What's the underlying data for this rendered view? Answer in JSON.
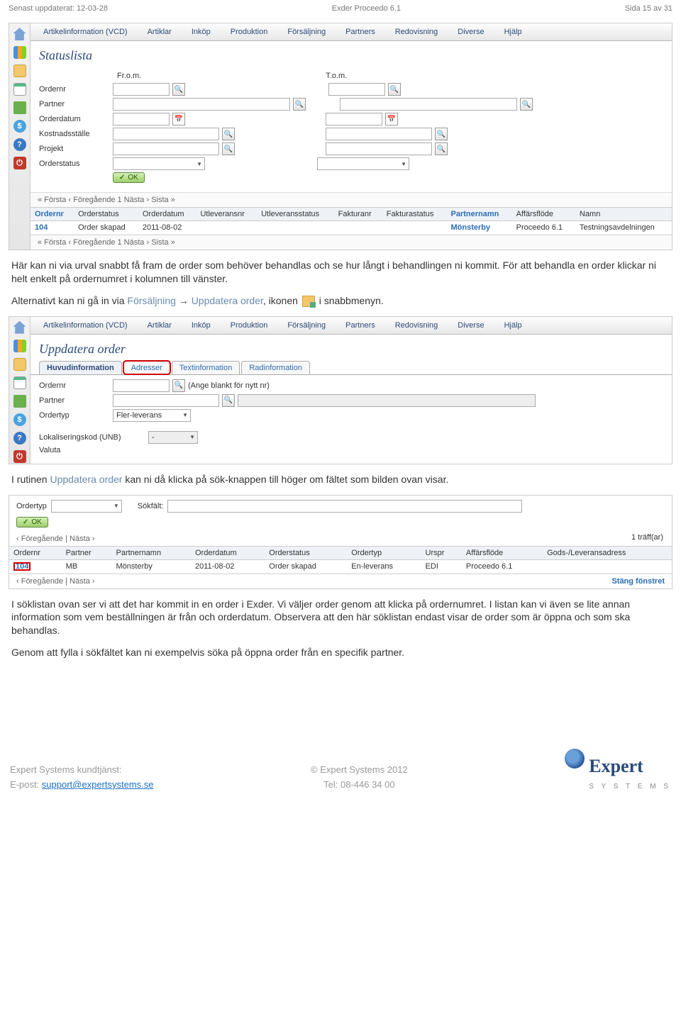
{
  "header": {
    "updated": "Senast uppdaterat: 12-03-28",
    "product": "Exder Proceedo 6.1",
    "page": "Sida 15 av 31"
  },
  "menubar": [
    "Artikelinformation (VCD)",
    "Artiklar",
    "Inköp",
    "Produktion",
    "Försäljning",
    "Partners",
    "Redovisning",
    "Diverse",
    "Hjälp"
  ],
  "shot1": {
    "title": "Statuslista",
    "col_from": "Fr.o.m.",
    "col_to": "T.o.m.",
    "labels": {
      "ordernr": "Ordernr",
      "partner": "Partner",
      "orderdatum": "Orderdatum",
      "kostnadsstalle": "Kostnadsställe",
      "projekt": "Projekt",
      "orderstatus": "Orderstatus"
    },
    "ok": "OK",
    "pager": "« Första ‹ Föregående 1 Nästa › Sista »",
    "table": {
      "headers": [
        "Ordernr",
        "Orderstatus",
        "Orderdatum",
        "Utleveransnr",
        "Utleveransstatus",
        "Fakturanr",
        "Fakturastatus",
        "Partnernamn",
        "Affärsflöde",
        "Namn"
      ],
      "row": [
        "104",
        "Order skapad",
        "2011-08-02",
        "",
        "",
        "",
        "",
        "Mönsterby",
        "Proceedo 6.1",
        "Testningsavdelningen"
      ]
    }
  },
  "para1": "Här kan ni via urval snabbt få fram de order som behöver behandlas och se hur långt i behandlingen ni kommit. För att behandla en order klickar ni helt enkelt på ordernumret i kolumnen till vänster.",
  "para2a": "Alternativt kan ni gå in via ",
  "para2_link1": "Försäljning",
  "para2_arrow": " → ",
  "para2_link2": "Uppdatera order",
  "para2b": ", ikonen ",
  "para2c": " i snabbmenyn.",
  "shot2": {
    "title": "Uppdatera order",
    "tabs": [
      "Huvudinformation",
      "Adresser",
      "Textinformation",
      "Radinformation"
    ],
    "labels": {
      "ordernr": "Ordernr",
      "ordernr_hint": "(Ange blankt för nytt nr)",
      "partner": "Partner",
      "ordertyp": "Ordertyp",
      "ordertyp_val": "Fler-leverans",
      "lokkod": "Lokaliseringskod (UNB)",
      "valuta": "Valuta"
    }
  },
  "para3a": "I rutinen ",
  "para3_link": "Uppdatera order",
  "para3b": " kan ni då klicka på sök-knappen till höger om fältet som bilden ovan visar.",
  "shot3": {
    "ordertyp": "Ordertyp",
    "sokfalt": "Sökfält:",
    "ok": "OK",
    "pager": "‹ Föregående | Nästa ›",
    "hits": "1 träff(ar)",
    "headers": [
      "Ordernr",
      "Partner",
      "Partnernamn",
      "Orderdatum",
      "Orderstatus",
      "Ordertyp",
      "Urspr",
      "Affärsflöde",
      "Gods-/Leveransadress"
    ],
    "row": [
      "104",
      "MB",
      "Mönsterby",
      "2011-08-02",
      "Order skapad",
      "En-leverans",
      "EDI",
      "Proceedo 6.1",
      ""
    ],
    "close": "Stäng fönstret"
  },
  "para4": "I söklistan ovan ser vi att det har kommit in en order i Exder. Vi väljer order genom att klicka på ordernumret. I listan kan vi även se lite annan information som vem beställningen är från och orderdatum. Observera att den här söklistan endast visar de order som är öppna och som ska behandlas.",
  "para5": "Genom att fylla i sökfältet kan ni exempelvis söka på öppna order från en specifik partner.",
  "footer": {
    "kundtjanst": "Expert Systems kundtjänst:",
    "epost_label": "E-post: ",
    "epost": "support@expertsystems.se",
    "copyright": "© Expert Systems 2012",
    "tel": "Tel: 08-446 34 00",
    "logo": "Expert",
    "logo_sub": "S Y S T E M S"
  }
}
